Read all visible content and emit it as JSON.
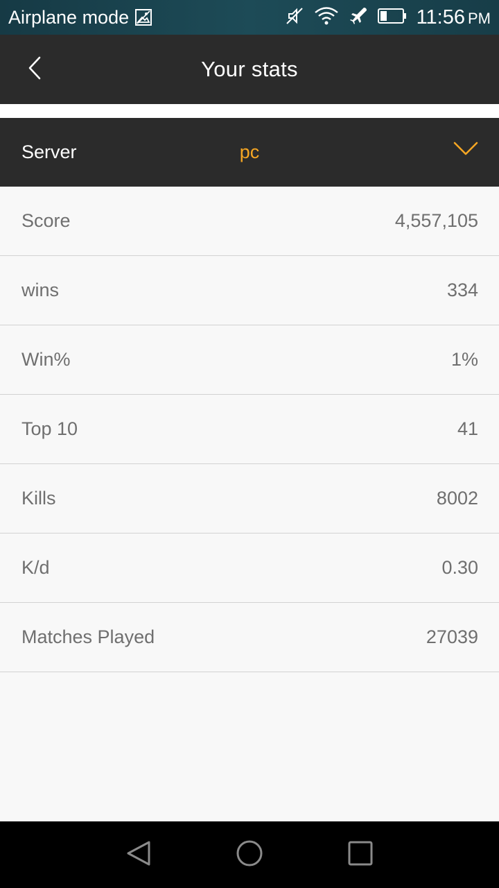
{
  "status_bar": {
    "mode_text": "Airplane mode",
    "time": "11:56",
    "ampm": "PM",
    "icons": [
      "image-notification-icon",
      "mute-icon",
      "wifi-icon",
      "airplane-icon",
      "battery-icon"
    ]
  },
  "app_bar": {
    "title": "Your stats",
    "back_icon": "chevron-left-icon"
  },
  "server": {
    "label": "Server",
    "value": "pc",
    "accent_color": "#f5a623",
    "dropdown_icon": "chevron-down-icon"
  },
  "stats": [
    {
      "label": "Score",
      "value": "4,557,105"
    },
    {
      "label": "wins",
      "value": "334"
    },
    {
      "label": "Win%",
      "value": "1%"
    },
    {
      "label": "Top 10",
      "value": "41"
    },
    {
      "label": "Kills",
      "value": "8002"
    },
    {
      "label": "K/d",
      "value": "0.30"
    },
    {
      "label": "Matches Played",
      "value": "27039"
    }
  ],
  "nav_bar": {
    "icons": [
      "back-triangle-icon",
      "home-circle-icon",
      "recents-square-icon"
    ]
  }
}
